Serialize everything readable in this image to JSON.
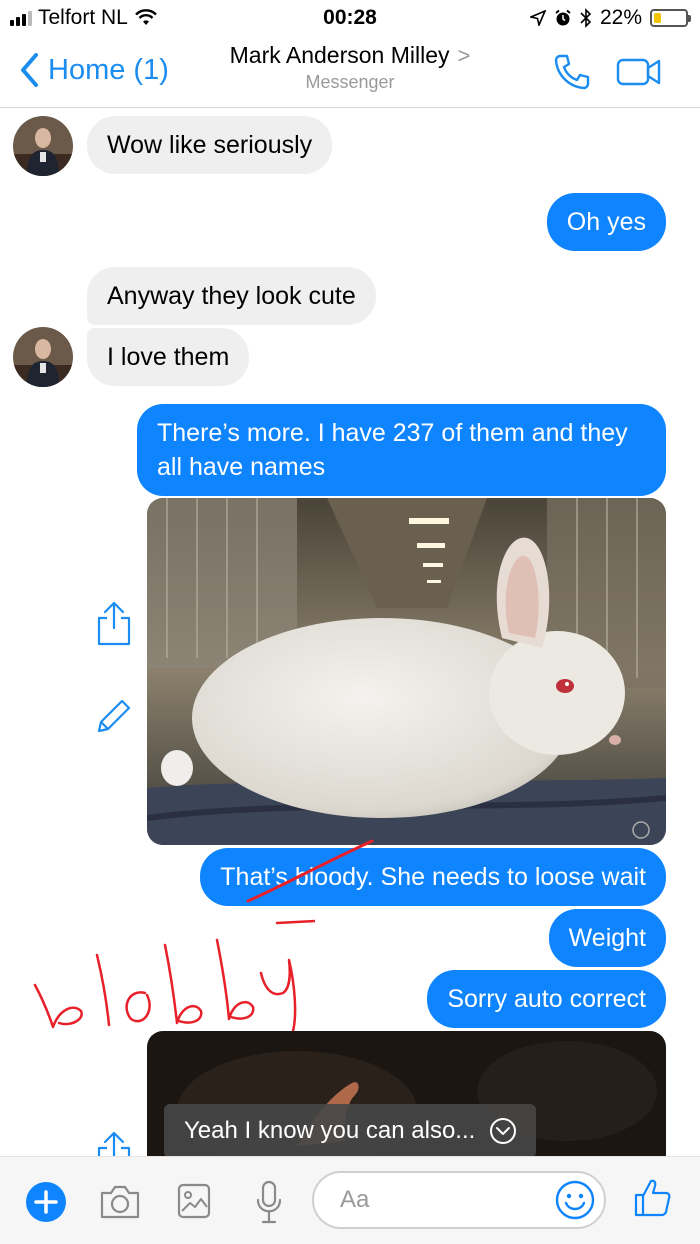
{
  "status_bar": {
    "carrier": "Telfort NL",
    "time": "00:28",
    "battery_percent": "22%",
    "battery_level": 0.22,
    "battery_color": "#f5c400"
  },
  "header": {
    "back_label": "Home (1)",
    "contact_name": "Mark Anderson Milley",
    "subtitle": "Messenger",
    "icons": [
      "chevron-left-icon",
      "phone-icon",
      "video-camera-icon"
    ]
  },
  "messages": [
    {
      "from": "contact",
      "text": "Wow like seriously"
    },
    {
      "from": "me",
      "text": "Oh yes"
    },
    {
      "from": "contact",
      "text": "Anyway they look cute"
    },
    {
      "from": "contact",
      "text": "I love them"
    },
    {
      "from": "me",
      "text": "There’s more. I have 237 of them and they all have names"
    },
    {
      "from": "me",
      "type": "photo",
      "icons": [
        "share-icon",
        "edit-pencil-icon"
      ]
    },
    {
      "from": "me",
      "text": "That’s bloody. She needs to loose wait"
    },
    {
      "from": "me",
      "text": "Weight"
    },
    {
      "from": "me",
      "text": "Sorry auto correct"
    },
    {
      "from": "me",
      "type": "photo",
      "icons": [
        "share-icon"
      ]
    }
  ],
  "annotation": {
    "handwritten": "blobby",
    "ink_color": "#e8202a"
  },
  "toast": {
    "text": "Yeah I know you can also...",
    "icon": "chevron-down-circle-icon"
  },
  "composer": {
    "placeholder": "Aa",
    "icons": [
      "plus-icon",
      "camera-icon",
      "image-icon",
      "microphone-icon",
      "emoji-icon",
      "thumbs-up-icon"
    ]
  },
  "colors": {
    "accent": "#0f84ff",
    "incoming_bubble": "#efefef"
  }
}
